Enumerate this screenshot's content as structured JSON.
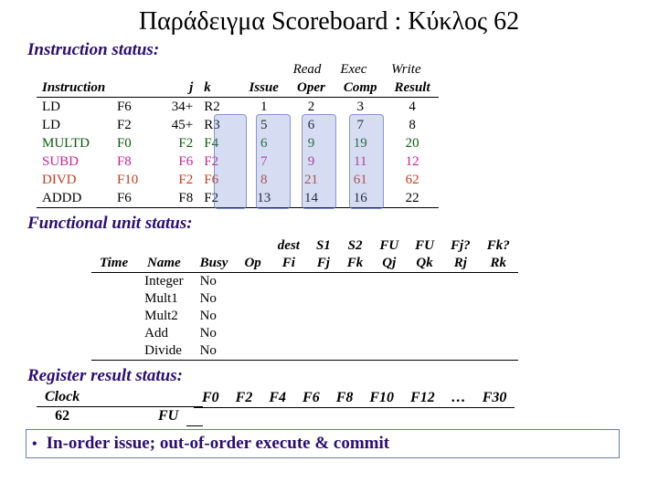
{
  "title": "Παράδειγμα Scoreboard : Κύκλος 62",
  "sections": {
    "inst": "Instruction status:",
    "fu": "Functional unit status:",
    "reg": "Register result status:"
  },
  "inst_headers_top": {
    "read": "Read",
    "exec": "Exec",
    "write": "Write"
  },
  "inst_headers": {
    "instruction": "Instruction",
    "j": "j",
    "k": "k",
    "issue": "Issue",
    "oper": "Oper",
    "comp": "Comp",
    "result": "Result"
  },
  "instructions": [
    {
      "op": "LD",
      "dest": "F6",
      "j": "34+",
      "k": "R2",
      "issue": "1",
      "read": "2",
      "exec": "3",
      "write": "4",
      "cls": "ldrow"
    },
    {
      "op": "LD",
      "dest": "F2",
      "j": "45+",
      "k": "R3",
      "issue": "5",
      "read": "6",
      "exec": "7",
      "write": "8",
      "cls": "ldrow"
    },
    {
      "op": "MULTD",
      "dest": "F0",
      "j": "F2",
      "k": "F4",
      "issue": "6",
      "read": "9",
      "exec": "19",
      "write": "20",
      "cls": "multrow"
    },
    {
      "op": "SUBD",
      "dest": "F8",
      "j": "F6",
      "k": "F2",
      "issue": "7",
      "read": "9",
      "exec": "11",
      "write": "12",
      "cls": "subrow"
    },
    {
      "op": "DIVD",
      "dest": "F10",
      "j": "F2",
      "k": "F6",
      "issue": "8",
      "read": "21",
      "exec": "61",
      "write": "62",
      "cls": "divrow"
    },
    {
      "op": "ADDD",
      "dest": "F6",
      "j": "F8",
      "k": "F2",
      "issue": "13",
      "read": "14",
      "exec": "16",
      "write": "22",
      "cls": "addrow"
    }
  ],
  "fu_headers_top": {
    "dest": "dest",
    "s1": "S1",
    "s2": "S2",
    "fu1": "FU",
    "fu2": "FU",
    "fj": "Fj?",
    "fk": "Fk?"
  },
  "fu_headers": {
    "time": "Time",
    "name": "Name",
    "busy": "Busy",
    "op": "Op",
    "fi": "Fi",
    "fj": "Fj",
    "fk": "Fk",
    "qj": "Qj",
    "qk": "Qk",
    "rj": "Rj",
    "rk": "Rk"
  },
  "fus": [
    {
      "name": "Integer",
      "busy": "No"
    },
    {
      "name": "Mult1",
      "busy": "No"
    },
    {
      "name": "Mult2",
      "busy": "No"
    },
    {
      "name": "Add",
      "busy": "No"
    },
    {
      "name": "Divide",
      "busy": "No"
    }
  ],
  "reg": {
    "clock_label": "Clock",
    "clock": "62",
    "fu_label": "FU",
    "cols": [
      "F0",
      "F2",
      "F4",
      "F6",
      "F8",
      "F10",
      "F12",
      "…",
      "F30"
    ]
  },
  "bullet": "In-order issue; out-of-order execute & commit"
}
